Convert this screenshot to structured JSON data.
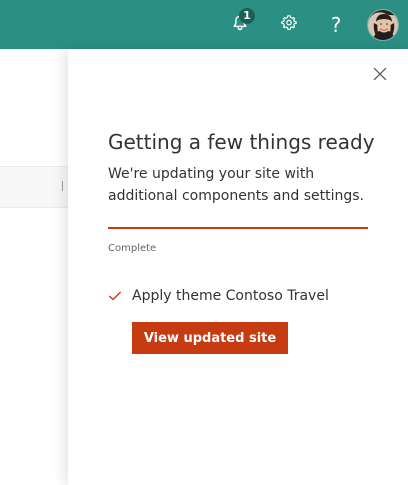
{
  "topbar": {
    "notification_count": "1",
    "icons": {
      "notifications": "bell-icon",
      "settings": "gear-icon",
      "help": "question-icon",
      "profile": "avatar"
    },
    "help_label": "?"
  },
  "panel": {
    "title": "Getting a few things ready",
    "description": "We're updating your site with additional components and settings.",
    "progress": 1.0,
    "status_label": "Complete",
    "task": {
      "label": "Apply theme Contoso Travel",
      "icon": "check-icon",
      "status": "done"
    },
    "button_label": "View updated site",
    "close_icon": "close-icon"
  },
  "colors": {
    "header": "#2b8f84",
    "accent": "#c63b12",
    "accent_light": "#f3d6cd",
    "panel_bg": "#ffffff"
  }
}
